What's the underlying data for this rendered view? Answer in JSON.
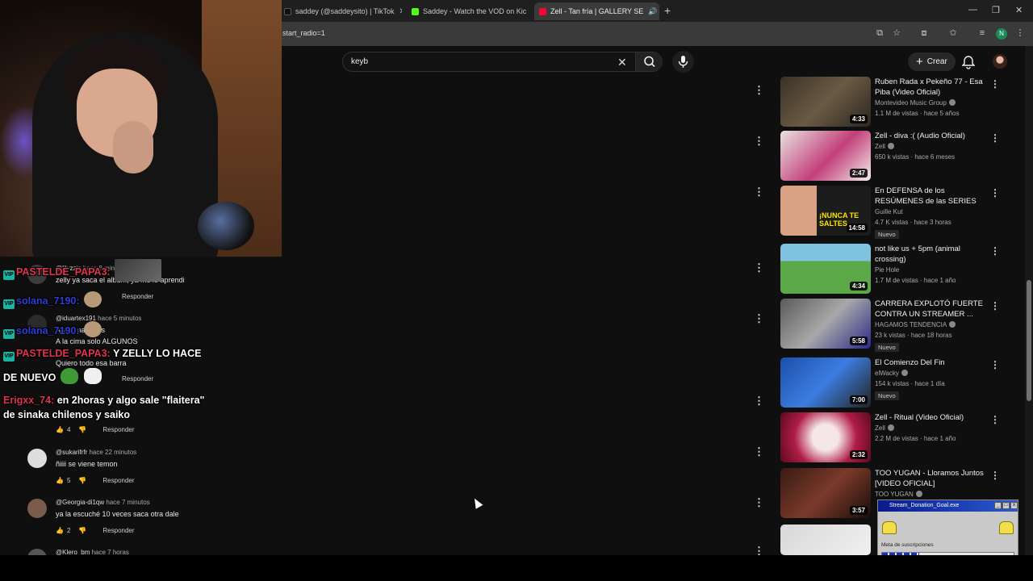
{
  "browser": {
    "tabs": [
      {
        "label": "saddey (@saddeysito) | TikTok",
        "color": "#111111"
      },
      {
        "label": "Saddey - Watch the VOD on Kic",
        "color": "#53fc18"
      },
      {
        "label": "Zell - Tan fría | GALLERY SE",
        "color": "#ff0033"
      }
    ],
    "url": "start_radio=1",
    "profile_initial": "N"
  },
  "youtube": {
    "search_value": "keyb",
    "create_label": "Crear"
  },
  "comments": [
    {
      "handle": "@lilyzzip",
      "time": "hace 8 minutos",
      "text": "zelly ya saca el album, ya me lo aprendi",
      "likes": "",
      "reply": "Responder"
    },
    {
      "handle": "@iduartex191",
      "time": "hace 5 minutos",
      "text1": "A la cima todos",
      "text2": "A la cima solo ALGUNOS",
      "likes": "",
      "reply": "Responder"
    },
    {
      "handle": "",
      "time": "",
      "text": "Quiero todo esa barra",
      "likes": "",
      "reply": "Responder"
    },
    {
      "handle": "",
      "time": "",
      "text": "",
      "likes": "4",
      "reply": "Responder"
    },
    {
      "handle": "@sukarifrfr",
      "time": "hace 22 minutos",
      "text": "ñiiii se viene temon",
      "likes": "5",
      "reply": "Responder"
    },
    {
      "handle": "@Georgia-di1qw",
      "time": "hace 7 minutos",
      "text": "ya la escuché 10 veces saca otra dale",
      "likes": "2",
      "reply": "Responder"
    },
    {
      "handle": "@Klero_bm",
      "time": "hace 7 horas",
      "text": "",
      "likes": "",
      "reply": ""
    }
  ],
  "chat": [
    {
      "user": "PASTELDE_PAPA3:",
      "message": ""
    },
    {
      "user": "solana_7190:",
      "message": ""
    },
    {
      "user": "solana_7190:",
      "message": ""
    },
    {
      "user": "PASTELDE_PAPA3:",
      "message": "Y ZELLY LO HACE"
    },
    {
      "user": "",
      "message": "DE NUEVO"
    },
    {
      "user": "Erigxx_74:",
      "message": "en 2horas y algo sale \"flaitera\""
    },
    {
      "user": "",
      "message": "de sinaka chilenos y saiko"
    }
  ],
  "recommended": [
    {
      "title": "Ruben Rada x Pekeño 77 - Esa Piba (Video Oficial)",
      "channel": "Montevideo Music Group",
      "stats": "1.1 M de vistas · hace 5 años",
      "duration": "4:33",
      "badge": ""
    },
    {
      "title": "Zell - diva :( (Audio Oficial)",
      "channel": "Zell",
      "stats": "650 k vistas · hace 6 meses",
      "duration": "2:47",
      "badge": ""
    },
    {
      "title": "En DEFENSA de los RESÚMENES de las SERIES",
      "channel": "Guille Kut",
      "stats": "4.7 K vistas · hace 3 horas",
      "duration": "14:58",
      "badge": "Nuevo"
    },
    {
      "title": "not like us + 5pm (animal crossing)",
      "channel": "Pie Hole",
      "stats": "1.7 M de vistas · hace 1 año",
      "duration": "4:34",
      "badge": ""
    },
    {
      "title": "CARRERA EXPLOTÓ FUERTE CONTRA UN STREAMER ...",
      "channel": "HAGAMOS TENDENCIA",
      "stats": "23 k vistas · hace 18 horas",
      "duration": "5:58",
      "badge": "Nuevo"
    },
    {
      "title": "El Comienzo Del Fin",
      "channel": "elWacky",
      "stats": "154 k vistas · hace 1 día",
      "duration": "7:00",
      "badge": "Nuevo"
    },
    {
      "title": "Zell - Ritual (Video Oficial)",
      "channel": "Zell",
      "stats": "2.2 M de vistas · hace 1 año",
      "duration": "2:32",
      "badge": ""
    },
    {
      "title": "TOO YUGAN - Lloramos Juntos [VIDEO OFICIAL] #HORRORGLO",
      "channel": "TOO YUGAN",
      "stats": "",
      "duration": "3:57",
      "badge": ""
    }
  ],
  "widget": {
    "title": "Stream_Donation_Goal.exe",
    "label": "Meta de suscripciones",
    "progress": 0.28
  }
}
